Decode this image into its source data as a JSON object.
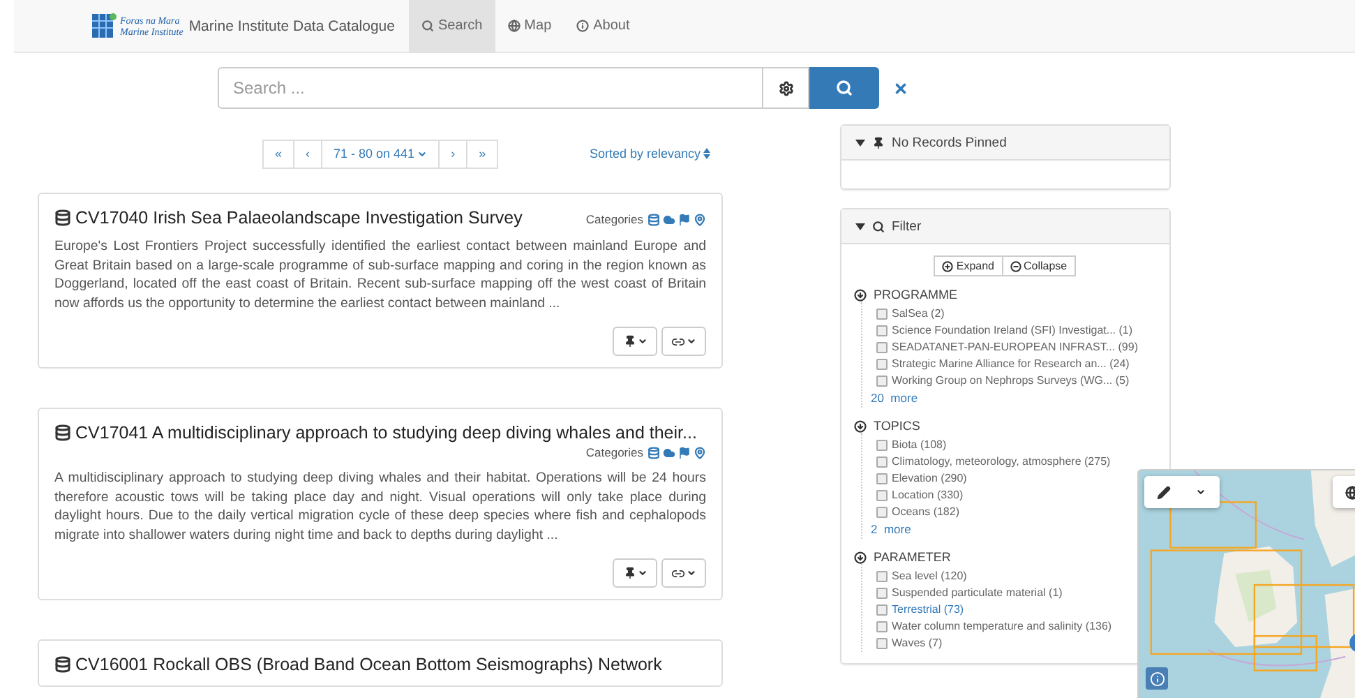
{
  "navbar": {
    "brand_line1": "Foras na Mara",
    "brand_line2": "Marine Institute",
    "title": "Marine Institute Data Catalogue",
    "tabs": [
      {
        "label": "Search",
        "selected": true
      },
      {
        "label": "Map",
        "selected": false
      },
      {
        "label": "About",
        "selected": false
      }
    ]
  },
  "search": {
    "placeholder": "Search ..."
  },
  "pagination": {
    "first": "«",
    "prev": "‹",
    "range": "71 - 80 on 441",
    "next": "›",
    "last": "»"
  },
  "sort": {
    "label": "Sorted by relevancy"
  },
  "records": [
    {
      "title": "CV17040 Irish Sea Palaeolandscape Investigation Survey",
      "categories_label": "Categories",
      "abstract": "Europe's Lost Frontiers Project successfully identified the earliest contact between mainland Europe and Great Britain based on a large-scale programme of sub-surface mapping and coring in the region known as Doggerland, located off the east coast of Britain. Recent sub-surface mapping off the west coast of Britain now affords us the opportunity to determine the earliest contact between mainland ..."
    },
    {
      "title": "CV17041 A multidisciplinary approach to studying deep diving whales and their...",
      "categories_label": "Categories",
      "abstract": "A multidisciplinary approach to studying deep diving whales and their habitat. Operations will be 24 hours therefore acoustic tows will be taking place day and night. Visual operations will only take place during daylight hours. Due to the daily vertical migration cycle of these deep species where fish and cephalopods migrate into shallower waters during night time and back to depths during daylight ..."
    },
    {
      "title": "CV16001 Rockall OBS (Broad Band Ocean Bottom Seismographs) Network"
    }
  ],
  "pinned": {
    "title": "No Records Pinned"
  },
  "filter": {
    "title": "Filter",
    "expand": "Expand",
    "collapse": "Collapse",
    "groups": [
      {
        "name": "PROGRAMME",
        "more": "20  more",
        "items": [
          {
            "label": "SalSea",
            "count": "(2)",
            "checked": false,
            "highlighted": false
          },
          {
            "label": "Science Foundation Ireland (SFI) Investigat...",
            "count": "(1)",
            "checked": false,
            "highlighted": false
          },
          {
            "label": "SEADATANET-PAN-EUROPEAN INFRAST...",
            "count": "(99)",
            "checked": false,
            "highlighted": false
          },
          {
            "label": "Strategic Marine Alliance for Research an...",
            "count": "(24)",
            "checked": false,
            "highlighted": false
          },
          {
            "label": "Working Group on Nephrops Surveys (WG...",
            "count": "(5)",
            "checked": false,
            "highlighted": false
          }
        ]
      },
      {
        "name": "TOPICS",
        "more": "2  more",
        "items": [
          {
            "label": "Biota",
            "count": "(108)",
            "checked": false,
            "highlighted": false
          },
          {
            "label": "Climatology, meteorology, atmosphere",
            "count": "(275)",
            "checked": false,
            "highlighted": false
          },
          {
            "label": "Elevation",
            "count": "(290)",
            "checked": false,
            "highlighted": false
          },
          {
            "label": "Location",
            "count": "(330)",
            "checked": false,
            "highlighted": false
          },
          {
            "label": "Oceans",
            "count": "(182)",
            "checked": false,
            "highlighted": false
          }
        ]
      },
      {
        "name": "PARAMETER",
        "items": [
          {
            "label": "Sea level",
            "count": "(120)",
            "checked": false,
            "highlighted": false
          },
          {
            "label": "Suspended particulate material",
            "count": "(1)",
            "checked": false,
            "highlighted": false
          },
          {
            "label": "Terrestrial",
            "count": "(73)",
            "checked": false,
            "highlighted": true
          },
          {
            "label": "Water column temperature and salinity",
            "count": "(136)",
            "checked": false,
            "highlighted": false
          },
          {
            "label": "Waves",
            "count": "(7)",
            "checked": false,
            "highlighted": false
          }
        ]
      }
    ]
  }
}
